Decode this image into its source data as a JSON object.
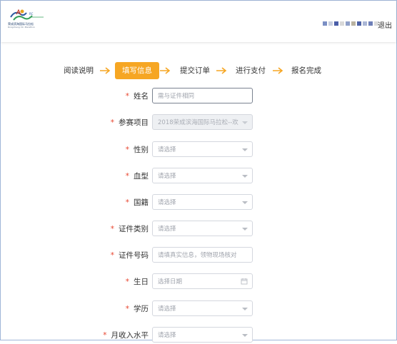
{
  "header": {
    "logo_line1": "荣成滨海国际马拉松",
    "logo_line2": "Rongcheng Int. Marathon",
    "logout_label": "退出",
    "user_block_colors": [
      "#7b8fc4",
      "#c8cfe0",
      "#4a5ea8",
      "#d9d9d9",
      "#8fa0c9",
      "#b9b2a0",
      "#4f63a6",
      "#aab6d6",
      "#6e7fb8",
      "#dcdcdc"
    ]
  },
  "steps": {
    "items": [
      {
        "label": "阅读说明",
        "active": false
      },
      {
        "label": "填写信息",
        "active": true
      },
      {
        "label": "提交订单",
        "active": false
      },
      {
        "label": "进行支付",
        "active": false
      },
      {
        "label": "报名完成",
        "active": false
      }
    ],
    "active_color": "#f6a623",
    "arrow_color": "#f6a623"
  },
  "form": {
    "required_mark": "*",
    "fields": [
      {
        "label": "姓名",
        "type": "text",
        "placeholder": "需与证件相同"
      },
      {
        "label": "参赛项目",
        "type": "select",
        "value": "2018荣成滨海国际马拉松--欢",
        "disabled": true
      },
      {
        "label": "性别",
        "type": "select",
        "placeholder": "请选择"
      },
      {
        "label": "血型",
        "type": "select",
        "placeholder": "请选择"
      },
      {
        "label": "国籍",
        "type": "select",
        "placeholder": "请选择"
      },
      {
        "label": "证件类别",
        "type": "select",
        "placeholder": "请选择"
      },
      {
        "label": "证件号码",
        "type": "text",
        "placeholder": "请填真实信息，领物现场核对"
      },
      {
        "label": "生日",
        "type": "date",
        "placeholder": "选择日期"
      },
      {
        "label": "学历",
        "type": "select",
        "placeholder": "请选择"
      },
      {
        "label": "月收入水平",
        "type": "select",
        "placeholder": "请选择"
      }
    ]
  }
}
